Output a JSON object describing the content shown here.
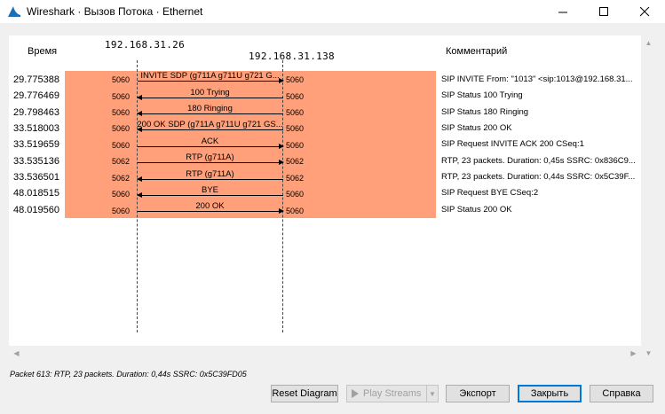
{
  "window": {
    "title": "Wireshark · Вызов Потока · Ethernet",
    "minimize_glyph": "—",
    "maximize_glyph": "☐",
    "close_glyph": "✕"
  },
  "header": {
    "time_label": "Время",
    "host_left": "192.168.31.26",
    "host_right": "192.168.31.138",
    "comment_label": "Комментарий"
  },
  "flows": [
    {
      "time": "29.775388",
      "port_left": "5060",
      "port_right": "5060",
      "label": "INVITE SDP (g711A g711U g721 G...",
      "direction": "right",
      "comment": "SIP INVITE From: \"1013\" <sip:1013@192.168.31..."
    },
    {
      "time": "29.776469",
      "port_left": "5060",
      "port_right": "5060",
      "label": "100 Trying",
      "direction": "left",
      "comment": "SIP Status 100 Trying"
    },
    {
      "time": "29.798463",
      "port_left": "5060",
      "port_right": "5060",
      "label": "180 Ringing",
      "direction": "left",
      "comment": "SIP Status 180 Ringing"
    },
    {
      "time": "33.518003",
      "port_left": "5060",
      "port_right": "5060",
      "label": "200 OK SDP (g711A g711U g721 GS...",
      "direction": "left",
      "comment": "SIP Status 200 OK"
    },
    {
      "time": "33.519659",
      "port_left": "5060",
      "port_right": "5060",
      "label": "ACK",
      "direction": "right",
      "comment": "SIP Request INVITE ACK 200 CSeq:1"
    },
    {
      "time": "33.535136",
      "port_left": "5062",
      "port_right": "5062",
      "label": "RTP (g711A)",
      "direction": "right",
      "comment": "RTP, 23 packets. Duration: 0,45s SSRC: 0x836C9..."
    },
    {
      "time": "33.536501",
      "port_left": "5062",
      "port_right": "5062",
      "label": "RTP (g711A)",
      "direction": "left",
      "comment": "RTP, 23 packets. Duration: 0,44s SSRC: 0x5C39F..."
    },
    {
      "time": "48.018515",
      "port_left": "5060",
      "port_right": "5060",
      "label": "BYE",
      "direction": "left",
      "comment": "SIP Request BYE CSeq:2"
    },
    {
      "time": "48.019560",
      "port_left": "5060",
      "port_right": "5060",
      "label": "200 OK",
      "direction": "right",
      "comment": "SIP Status 200 OK"
    }
  ],
  "status_text": "Packet 613: RTP, 23 packets. Duration: 0,44s SSRC: 0x5C39FD05",
  "buttons": {
    "reset_diagram": "Reset Diagram",
    "play_streams": "Play Streams",
    "export": "Экспорт",
    "close": "Закрыть",
    "help": "Справка"
  },
  "colors": {
    "flow_background": "#ffa07a",
    "focus_border": "#0078d7",
    "shark_fin": "#1a6fb5"
  },
  "icons": {
    "app": "wireshark-fin-icon",
    "play": "play-icon",
    "dropdown": "chevron-down-icon"
  }
}
